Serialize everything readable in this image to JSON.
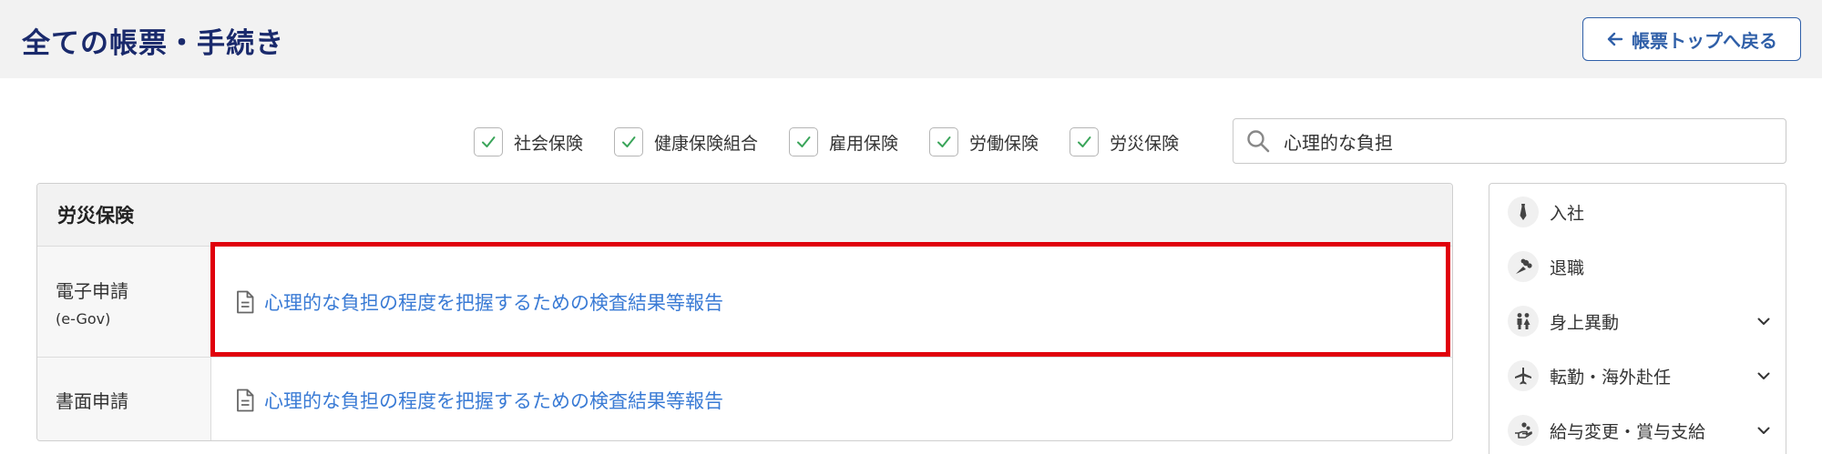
{
  "header": {
    "title": "全ての帳票・手続き",
    "back_button_label": "帳票トップへ戻る"
  },
  "filters": [
    {
      "label": "社会保険",
      "checked": true
    },
    {
      "label": "健康保険組合",
      "checked": true
    },
    {
      "label": "雇用保険",
      "checked": true
    },
    {
      "label": "労働保険",
      "checked": true
    },
    {
      "label": "労災保険",
      "checked": true
    }
  ],
  "search": {
    "value": "心理的な負担"
  },
  "section": {
    "title": "労災保険",
    "rows": [
      {
        "label": "電子申請",
        "sublabel": "(e-Gov)",
        "link": "心理的な負担の程度を把握するための検査結果等報告",
        "highlighted": true
      },
      {
        "label": "書面申請",
        "sublabel": "",
        "link": "心理的な負担の程度を把握するための検査結果等報告",
        "highlighted": false
      }
    ]
  },
  "sidebar": {
    "items": [
      {
        "label": "入社",
        "icon": "necktie-icon",
        "expandable": false
      },
      {
        "label": "退職",
        "icon": "bouquet-icon",
        "expandable": false
      },
      {
        "label": "身上異動",
        "icon": "couple-icon",
        "expandable": true
      },
      {
        "label": "転勤・海外赴任",
        "icon": "airplane-icon",
        "expandable": true
      },
      {
        "label": "給与変更・賞与支給",
        "icon": "money-hand-icon",
        "expandable": true
      }
    ]
  },
  "colors": {
    "title": "#1a2a6c",
    "link": "#3a7bd5",
    "check": "#3aa55a",
    "highlight": "#e0000b",
    "button_border": "#2f5fa8"
  }
}
